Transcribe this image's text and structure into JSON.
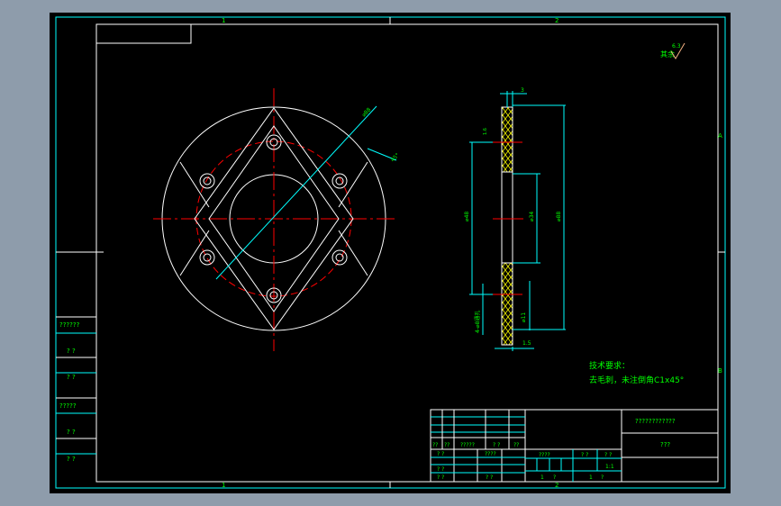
{
  "colors": {
    "background": "#000000",
    "frame": "#ffffff",
    "border": "#00ffff",
    "text": "#00ff00",
    "centerline": "#ff0000",
    "hatch": "#ffff00"
  },
  "border_marks": {
    "top_left": "1",
    "top_right": "2",
    "bottom_left": "1",
    "bottom_right": "2",
    "right_top": "A",
    "right_bottom": "B"
  },
  "roughness": {
    "label": "其余",
    "value": "6.3"
  },
  "tech_requirements": {
    "title": "技术要求：",
    "line1": "去毛刺，未注倒角C1x45°"
  },
  "side_view_dims": {
    "top": "3",
    "left": "⌀48",
    "mid": "⌀34",
    "right": "⌀88",
    "bottom": "1.5",
    "hole": "4-⌀8通孔",
    "flat": "⌀11",
    "rough": "1.6"
  },
  "front_view_dims": {
    "diag": "⌀88",
    "angle": "45°"
  },
  "left_panel": [
    "??????",
    "? ?",
    "? ?",
    "?????",
    "? ?",
    "? ?"
  ],
  "title_block": {
    "drawing_name": "????????????",
    "company": "???",
    "row_labels": [
      "??",
      "??",
      "?????",
      "? ?",
      "??"
    ],
    "design_labels": [
      "? ?",
      "????",
      "? ?",
      "? ?",
      "? ?"
    ],
    "stage_label": "????",
    "weight_label": "? ?",
    "scale_label": "? ?",
    "scale_value": "1:1",
    "sheet": "1",
    "sheets": "1",
    "sheet_of": "?",
    "sheets_of": "?"
  }
}
